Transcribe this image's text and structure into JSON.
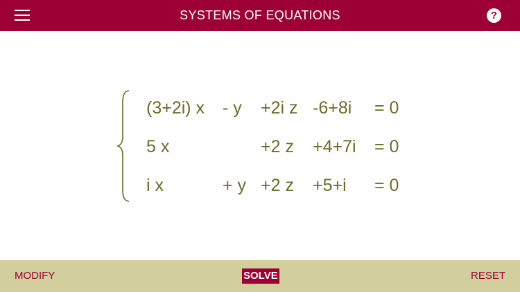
{
  "header": {
    "title": "SYSTEMS OF EQUATIONS",
    "menu_icon": "hamburger-menu-icon",
    "help_icon": "question-icon",
    "help_glyph": "?"
  },
  "system": {
    "rows": [
      {
        "x": "(3+2i) x",
        "y": "- y",
        "z": "+2i z",
        "c": "-6+8i",
        "eq": "= 0"
      },
      {
        "x": "5 x",
        "y": "",
        "z": "+2 z",
        "c": "+4+7i",
        "eq": "= 0"
      },
      {
        "x": "i x",
        "y": "+ y",
        "z": "+2 z",
        "c": "+5+i",
        "eq": "= 0"
      }
    ]
  },
  "footer": {
    "modify_label": "MODIFY",
    "solve_label": "SOLVE",
    "reset_label": "RESET"
  },
  "colors": {
    "header_bg": "#9c0035",
    "footer_bg": "#d2cf9c",
    "equation_text": "#6b6b2a",
    "button_text": "#9c0035"
  }
}
